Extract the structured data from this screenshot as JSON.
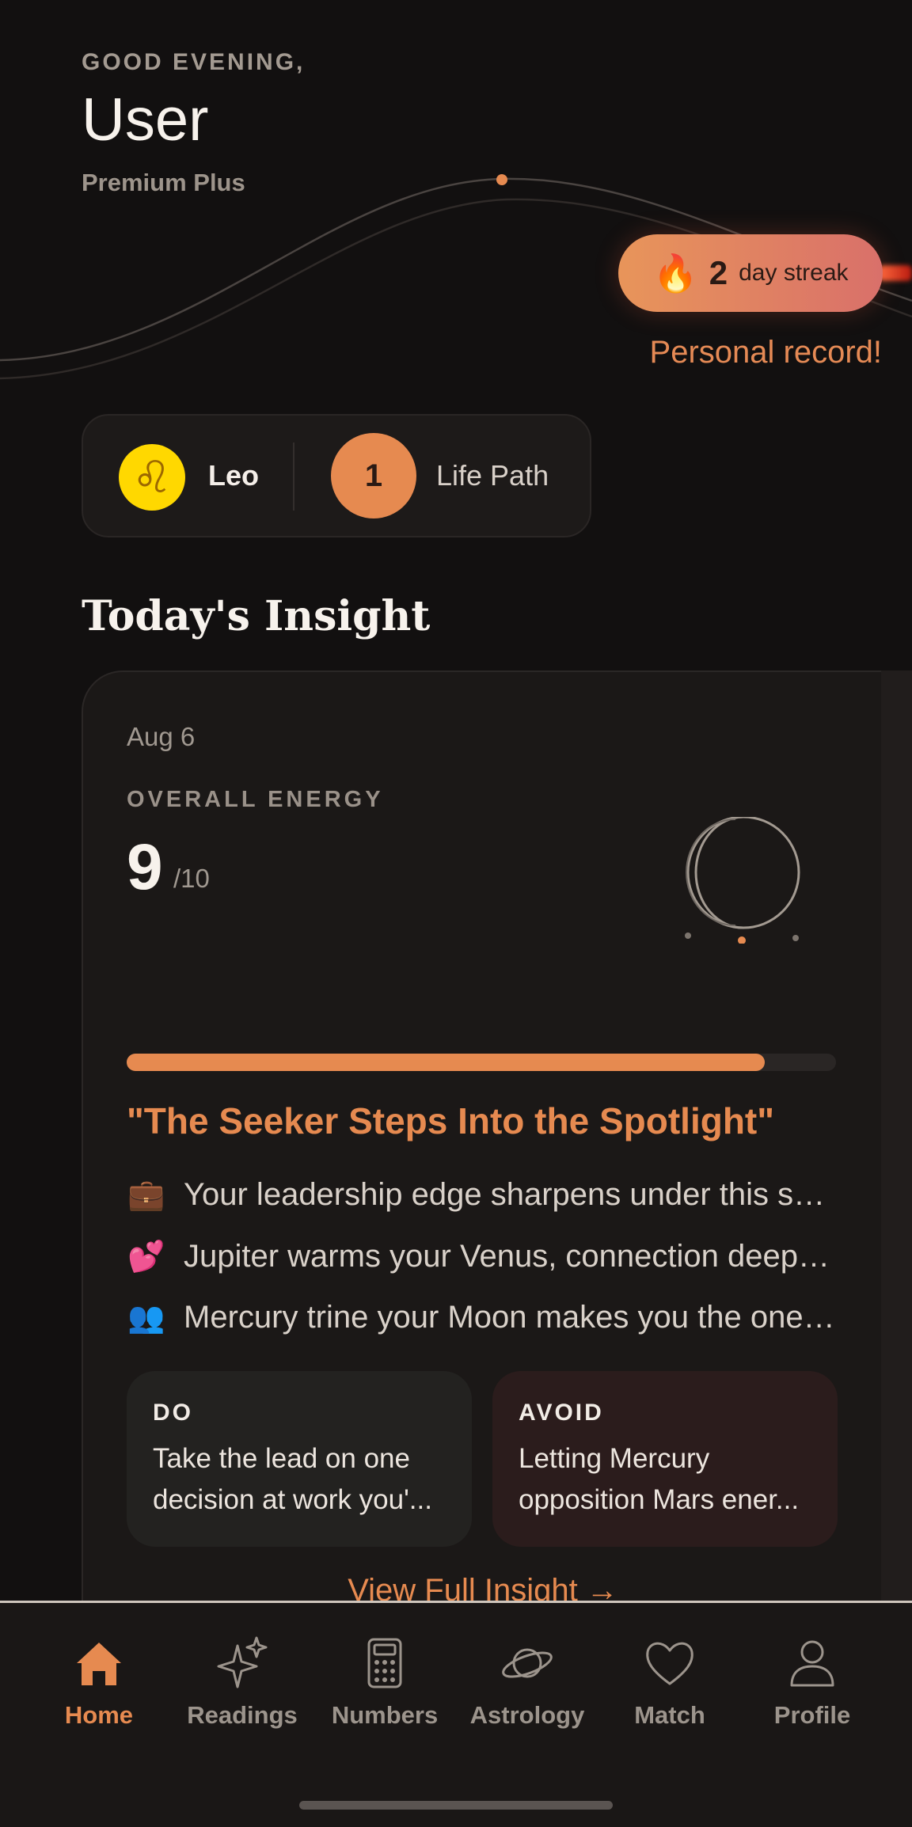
{
  "header": {
    "greeting": "GOOD EVENING,",
    "username": "User",
    "tier": "Premium Plus"
  },
  "streak": {
    "icon": "fire-icon",
    "count": "2",
    "label": "day streak",
    "record": "Personal record!"
  },
  "profile_signs": {
    "zodiac": {
      "icon": "leo-icon",
      "glyph": "♌",
      "label": "Leo"
    },
    "life_path": {
      "number": "1",
      "label": "Life Path"
    }
  },
  "section_title": "Today's Insight",
  "insight": {
    "date": "Aug 6",
    "energy_label": "OVERALL ENERGY",
    "energy_value": "9",
    "energy_max": "/10",
    "energy_fraction": 0.9,
    "headline": "\"The Seeker Steps Into the Spotlight\"",
    "bullets": [
      {
        "emoji": "💼",
        "icon": "briefcase-icon",
        "text": "Your leadership edge sharpens under this sky today"
      },
      {
        "emoji": "💕",
        "icon": "hearts-icon",
        "text": "Jupiter warms your Venus, connection deepens"
      },
      {
        "emoji": "👥",
        "icon": "people-icon",
        "text": "Mercury trine your Moon makes you the one people listen to"
      }
    ],
    "do": {
      "title": "DO",
      "text": "Take the lead on one decision at work you'..."
    },
    "avoid": {
      "title": "AVOID",
      "text": "Letting Mercury opposition Mars ener..."
    },
    "view_full": "View Full Insight →"
  },
  "tabs": [
    {
      "label": "Home",
      "icon": "home-icon",
      "active": true
    },
    {
      "label": "Readings",
      "icon": "sparkles-icon",
      "active": false
    },
    {
      "label": "Numbers",
      "icon": "calculator-icon",
      "active": false
    },
    {
      "label": "Astrology",
      "icon": "planet-icon",
      "active": false
    },
    {
      "label": "Match",
      "icon": "heart-icon",
      "active": false
    },
    {
      "label": "Profile",
      "icon": "user-icon",
      "active": false
    }
  ],
  "colors": {
    "background": "#121010",
    "accent": "#e68a50",
    "card": "#1b1817",
    "zodiac_badge": "#ffd800"
  }
}
